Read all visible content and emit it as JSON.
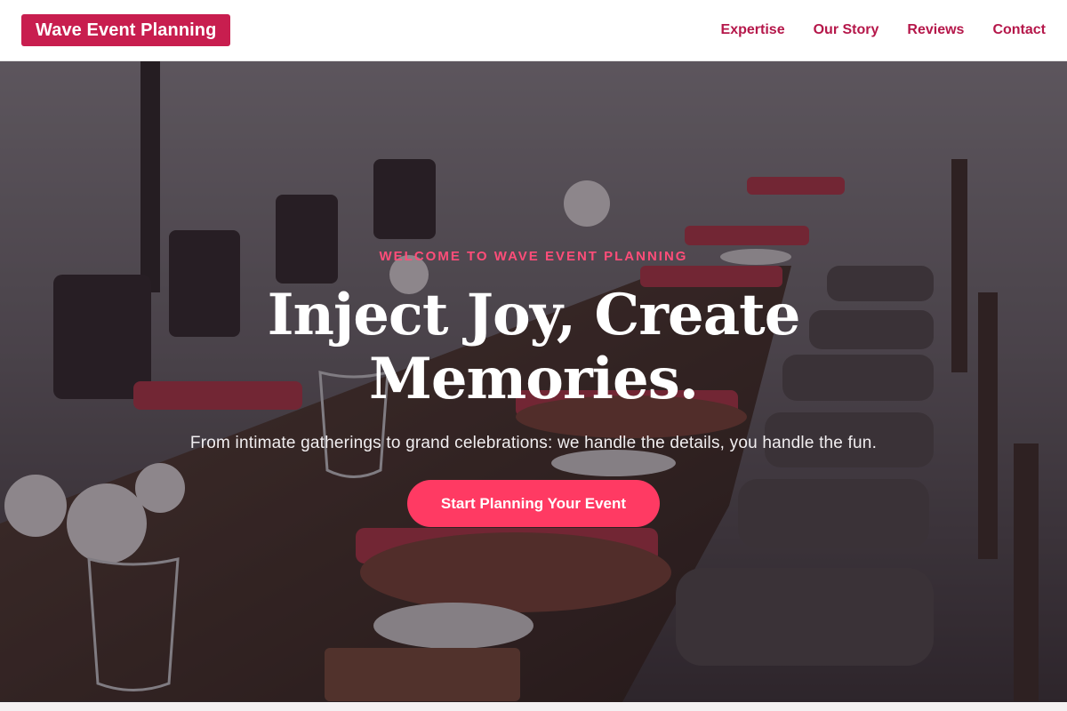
{
  "header": {
    "logo_text": "Wave Event Planning",
    "nav": [
      "Expertise",
      "Our Story",
      "Reviews",
      "Contact"
    ]
  },
  "hero": {
    "kicker": "WELCOME TO WAVE EVENT PLANNING",
    "headline": "Inject Joy, Create Memories.",
    "subtext": "From intimate gatherings to grand celebrations: we handle the details, you handle the fun.",
    "cta_label": "Start Planning Your Event"
  },
  "colors": {
    "brand": "#c81e4f",
    "nav_text": "#b5174a",
    "accent": "#ff3a63",
    "kicker": "#ff4d79"
  }
}
